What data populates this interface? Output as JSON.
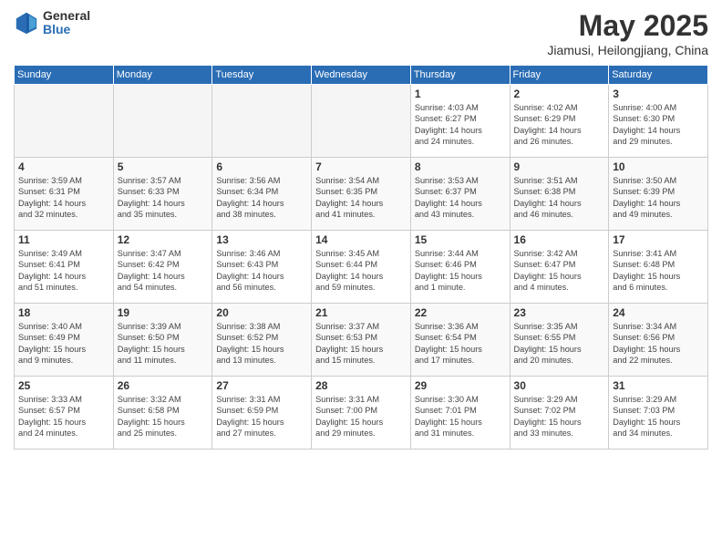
{
  "header": {
    "logo_general": "General",
    "logo_blue": "Blue",
    "month_title": "May 2025",
    "location": "Jiamusi, Heilongjiang, China"
  },
  "weekdays": [
    "Sunday",
    "Monday",
    "Tuesday",
    "Wednesday",
    "Thursday",
    "Friday",
    "Saturday"
  ],
  "weeks": [
    [
      {
        "day": "",
        "info": ""
      },
      {
        "day": "",
        "info": ""
      },
      {
        "day": "",
        "info": ""
      },
      {
        "day": "",
        "info": ""
      },
      {
        "day": "1",
        "info": "Sunrise: 4:03 AM\nSunset: 6:27 PM\nDaylight: 14 hours\nand 24 minutes."
      },
      {
        "day": "2",
        "info": "Sunrise: 4:02 AM\nSunset: 6:29 PM\nDaylight: 14 hours\nand 26 minutes."
      },
      {
        "day": "3",
        "info": "Sunrise: 4:00 AM\nSunset: 6:30 PM\nDaylight: 14 hours\nand 29 minutes."
      }
    ],
    [
      {
        "day": "4",
        "info": "Sunrise: 3:59 AM\nSunset: 6:31 PM\nDaylight: 14 hours\nand 32 minutes."
      },
      {
        "day": "5",
        "info": "Sunrise: 3:57 AM\nSunset: 6:33 PM\nDaylight: 14 hours\nand 35 minutes."
      },
      {
        "day": "6",
        "info": "Sunrise: 3:56 AM\nSunset: 6:34 PM\nDaylight: 14 hours\nand 38 minutes."
      },
      {
        "day": "7",
        "info": "Sunrise: 3:54 AM\nSunset: 6:35 PM\nDaylight: 14 hours\nand 41 minutes."
      },
      {
        "day": "8",
        "info": "Sunrise: 3:53 AM\nSunset: 6:37 PM\nDaylight: 14 hours\nand 43 minutes."
      },
      {
        "day": "9",
        "info": "Sunrise: 3:51 AM\nSunset: 6:38 PM\nDaylight: 14 hours\nand 46 minutes."
      },
      {
        "day": "10",
        "info": "Sunrise: 3:50 AM\nSunset: 6:39 PM\nDaylight: 14 hours\nand 49 minutes."
      }
    ],
    [
      {
        "day": "11",
        "info": "Sunrise: 3:49 AM\nSunset: 6:41 PM\nDaylight: 14 hours\nand 51 minutes."
      },
      {
        "day": "12",
        "info": "Sunrise: 3:47 AM\nSunset: 6:42 PM\nDaylight: 14 hours\nand 54 minutes."
      },
      {
        "day": "13",
        "info": "Sunrise: 3:46 AM\nSunset: 6:43 PM\nDaylight: 14 hours\nand 56 minutes."
      },
      {
        "day": "14",
        "info": "Sunrise: 3:45 AM\nSunset: 6:44 PM\nDaylight: 14 hours\nand 59 minutes."
      },
      {
        "day": "15",
        "info": "Sunrise: 3:44 AM\nSunset: 6:46 PM\nDaylight: 15 hours\nand 1 minute."
      },
      {
        "day": "16",
        "info": "Sunrise: 3:42 AM\nSunset: 6:47 PM\nDaylight: 15 hours\nand 4 minutes."
      },
      {
        "day": "17",
        "info": "Sunrise: 3:41 AM\nSunset: 6:48 PM\nDaylight: 15 hours\nand 6 minutes."
      }
    ],
    [
      {
        "day": "18",
        "info": "Sunrise: 3:40 AM\nSunset: 6:49 PM\nDaylight: 15 hours\nand 9 minutes."
      },
      {
        "day": "19",
        "info": "Sunrise: 3:39 AM\nSunset: 6:50 PM\nDaylight: 15 hours\nand 11 minutes."
      },
      {
        "day": "20",
        "info": "Sunrise: 3:38 AM\nSunset: 6:52 PM\nDaylight: 15 hours\nand 13 minutes."
      },
      {
        "day": "21",
        "info": "Sunrise: 3:37 AM\nSunset: 6:53 PM\nDaylight: 15 hours\nand 15 minutes."
      },
      {
        "day": "22",
        "info": "Sunrise: 3:36 AM\nSunset: 6:54 PM\nDaylight: 15 hours\nand 17 minutes."
      },
      {
        "day": "23",
        "info": "Sunrise: 3:35 AM\nSunset: 6:55 PM\nDaylight: 15 hours\nand 20 minutes."
      },
      {
        "day": "24",
        "info": "Sunrise: 3:34 AM\nSunset: 6:56 PM\nDaylight: 15 hours\nand 22 minutes."
      }
    ],
    [
      {
        "day": "25",
        "info": "Sunrise: 3:33 AM\nSunset: 6:57 PM\nDaylight: 15 hours\nand 24 minutes."
      },
      {
        "day": "26",
        "info": "Sunrise: 3:32 AM\nSunset: 6:58 PM\nDaylight: 15 hours\nand 25 minutes."
      },
      {
        "day": "27",
        "info": "Sunrise: 3:31 AM\nSunset: 6:59 PM\nDaylight: 15 hours\nand 27 minutes."
      },
      {
        "day": "28",
        "info": "Sunrise: 3:31 AM\nSunset: 7:00 PM\nDaylight: 15 hours\nand 29 minutes."
      },
      {
        "day": "29",
        "info": "Sunrise: 3:30 AM\nSunset: 7:01 PM\nDaylight: 15 hours\nand 31 minutes."
      },
      {
        "day": "30",
        "info": "Sunrise: 3:29 AM\nSunset: 7:02 PM\nDaylight: 15 hours\nand 33 minutes."
      },
      {
        "day": "31",
        "info": "Sunrise: 3:29 AM\nSunset: 7:03 PM\nDaylight: 15 hours\nand 34 minutes."
      }
    ]
  ]
}
